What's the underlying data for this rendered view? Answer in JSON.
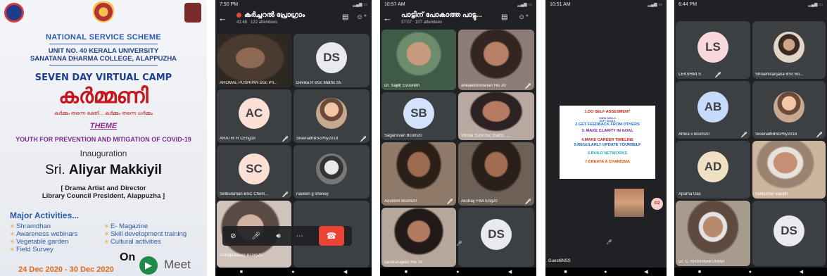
{
  "colors": {
    "red": "#ea4335",
    "meet_bg": "#202124",
    "tile_bg": "#3c4043",
    "poster_blue": "#2b5aa8",
    "poster_red": "#c4161c"
  },
  "poster": {
    "org": "NATIONAL SERVICE SCHEME",
    "unit_line1": "UNIT NO. 40 KERALA UNIVERSITY",
    "unit_line2": "SANATANA DHARMA COLLEGE, ALAPPUZHA",
    "camp": "SEVEN DAY VIRTUAL CAMP",
    "camp_name": "കർമ്മണി",
    "camp_tagline": "കർമ്മം തന്നെ ഭക്തി... കർമ്മം തന്നെ ധർമ്മം",
    "theme_label": "THEME",
    "theme": "YOUTH FOR PREVENTION AND MITIGATION OF COVID-19",
    "inauguration": "Inauguration",
    "guest_prefix": "Sri.",
    "guest_name": "Aliyar Makkiyil",
    "guest_role1": "[ Drama Artist and Director",
    "guest_role2": "Library Council President,  Alappuzha ]",
    "activities_title": "Major Activities...",
    "activities_left": [
      "Shramdhan",
      "Awareness webinars",
      "Vegetable garden",
      "Field Survey"
    ],
    "activities_right": [
      "E- Magazine",
      "Skill development training",
      "Cultural activities"
    ],
    "dates": "24 Dec 2020 - 30 Dec 2020",
    "on": "On",
    "meet": "Meet"
  },
  "screen1": {
    "time": "7:50 PM",
    "title": "കർച്ചറൽ പ്രോഗ്രാം",
    "duration": "41:46",
    "attendees": "122 attendees",
    "tiles": [
      {
        "name": "AROMAL PUSHPAN BSc Ph...",
        "initials": ""
      },
      {
        "name": "Devika R BSc Maths S5",
        "initials": "DS"
      },
      {
        "name": "ARATHI R CEng18",
        "initials": "AC"
      },
      {
        "name": "SreenathBScPhy2018",
        "initials": ""
      },
      {
        "name": "Sethuraman BSC Chem...",
        "initials": "SC"
      },
      {
        "name": "naveen g shenoy",
        "initials": ""
      },
      {
        "name": "Ardrapradeep Bcom20",
        "initials": ""
      }
    ]
  },
  "screen2": {
    "time": "10:57 AM",
    "title": "പാട്ടിന് പോകാത്ത പാട്ടു...",
    "duration": "37:07",
    "attendees": "107 attendees",
    "tiles": [
      {
        "name": "Dr. Sajith Evooreth",
        "initials": ""
      },
      {
        "name": "anilalekshmanan His 20",
        "initials": ""
      },
      {
        "name": "Sagarsivan Bcom20",
        "initials": "SB"
      },
      {
        "name": "Vrinda Sunil bsc maths ...",
        "initials": ""
      },
      {
        "name": "Arjunom Bcom20",
        "initials": ""
      },
      {
        "name": "Akshay FBA Eng20",
        "initials": ""
      },
      {
        "name": "sandrasajeev His 20",
        "initials": ""
      },
      {
        "name": "",
        "initials": "DS"
      }
    ]
  },
  "screen3": {
    "time": "10:51 AM",
    "presentation": [
      "1.DO SELF ASSESMENT",
      "HARD SKILLS",
      "SOFT SKILLS",
      "2.GET FEEDBACK FROM OTHERS",
      "3. MAKE CLARITY IN GOAL",
      "4.MAKE CAREER TIMELINE",
      "5.REGULARLY UPDATE YOURSELF",
      "6.BUILD NETWORKS",
      "7.CREATA A CHARISMA"
    ],
    "badge": "G2",
    "self_name": "Guest6NSS"
  },
  "screen4": {
    "time": "6:44 PM",
    "tiles": [
      {
        "name": "LEKSHMI S",
        "initials": "LS"
      },
      {
        "name": "ShreeNiranjana BSc Bo...",
        "initials": ""
      },
      {
        "name": "Athira v Bcom20",
        "initials": "AB"
      },
      {
        "name": "SreenathBScPhy2018",
        "initials": ""
      },
      {
        "name": "Aparna Das",
        "initials": "AD"
      },
      {
        "name": "harikumar vairath",
        "initials": ""
      },
      {
        "name": "Dr. C. KRISHNAKUMAR",
        "initials": ""
      },
      {
        "name": "",
        "initials": "DS"
      }
    ]
  },
  "icons": {
    "back": "arrow-back-icon",
    "captions": "captions-icon",
    "add_person": "add-person-icon",
    "mic_off": "mic-off-icon",
    "camera_off": "camera-off-icon",
    "audio": "speaker-icon",
    "more": "more-icon",
    "end_call": "end-call-icon"
  }
}
